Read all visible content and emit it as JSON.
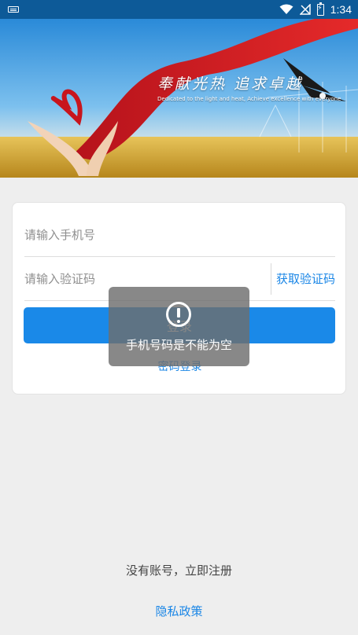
{
  "status_bar": {
    "time": "1:34",
    "icons": [
      "keyboard-icon",
      "wifi-icon",
      "no-signal-icon",
      "battery-charging-icon"
    ]
  },
  "banner": {
    "slogan": "奉献光热 追求卓越",
    "slogan_en": "Dedicated to the light and heat, Achieve excellence with everyone"
  },
  "form": {
    "phone_placeholder": "请输入手机号",
    "code_placeholder": "请输入验证码",
    "get_code_label": "获取验证码",
    "login_label": "登录",
    "password_login_label": "密码登录"
  },
  "toast": {
    "icon": "alert-circle-icon",
    "message": "手机号码是不能为空"
  },
  "footer": {
    "register_label": "没有账号，立即注册",
    "privacy_label": "隐私政策"
  },
  "colors": {
    "status_bar": "#0d5a98",
    "accent": "#1a89e8",
    "link": "#1a86e6",
    "background": "#eeeeee"
  }
}
